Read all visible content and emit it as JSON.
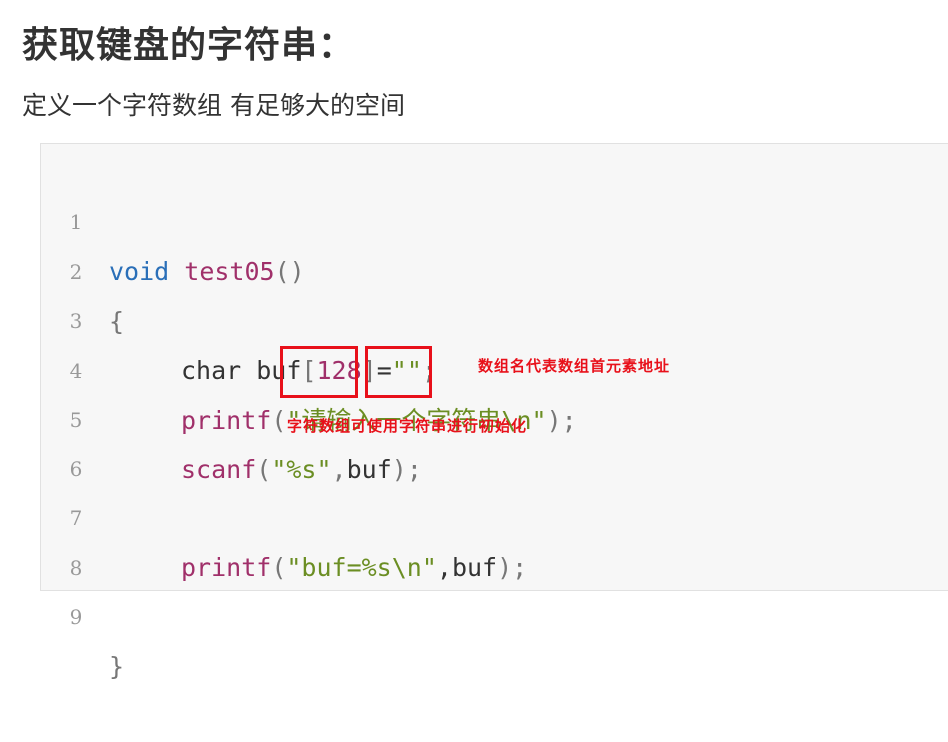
{
  "heading": {
    "title": "获取键盘的字符串：",
    "subtitle": "定义一个字符数组 有足够大的空间"
  },
  "code": {
    "line1": {
      "num": "1",
      "kw": "void",
      "fn": "test05",
      "rest": "()"
    },
    "line2": {
      "num": "2",
      "text": "{"
    },
    "line3": {
      "num": "3",
      "a": "char buf",
      "b": "[",
      "num_val": "128",
      "c": "]",
      "d": "=",
      "str": "\"\"",
      "e": ";"
    },
    "line4": {
      "num": "4",
      "fn": "printf",
      "a": "(",
      "str": "\"请输入一个字符串\\n\"",
      "b": ");"
    },
    "line5": {
      "num": "5",
      "fn": "scanf",
      "a": "(",
      "str": "\"%s\"",
      "b": ",",
      "c": "buf",
      "d": ");"
    },
    "line6": {
      "num": "6"
    },
    "line7": {
      "num": "7",
      "fn": "printf",
      "a": "(",
      "str": "\"buf=%s\\n\"",
      "b": ",buf",
      "c": ");"
    },
    "line8": {
      "num": "8"
    },
    "line9": {
      "num": "9",
      "text": "}"
    }
  },
  "annotations": {
    "note1": "数组名代表数组首元素地址",
    "note2": "字符数组可使用字符串进行初始化"
  },
  "colors": {
    "highlight": "#e8101a",
    "keyword": "#2a6fb8",
    "function": "#a0306a",
    "string": "#6b8e23"
  }
}
